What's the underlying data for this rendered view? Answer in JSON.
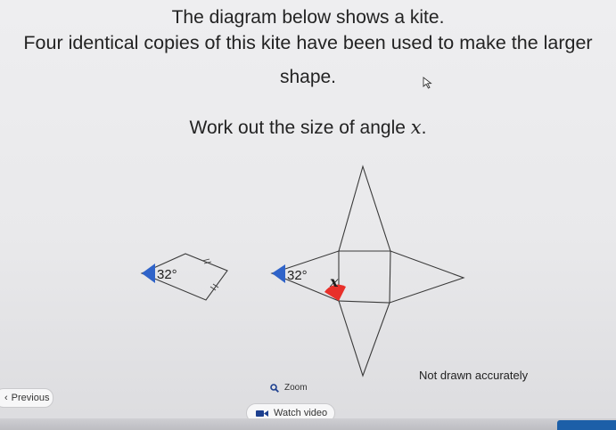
{
  "question": {
    "line1": "The diagram below shows a kite.",
    "line2": "Four identical copies of this kite have been used to make the larger",
    "line3": "shape.",
    "line4_prefix": "Work out the size of angle ",
    "line4_var": "x",
    "line4_suffix": "."
  },
  "diagram": {
    "kite_angle_label": "32°",
    "shape_angle_label": "32°",
    "unknown_label": "x",
    "marker_color": "#2f63c9",
    "highlight_color": "#e8302a",
    "note": "Not drawn accurately"
  },
  "controls": {
    "zoom_label": "Zoom",
    "zoom_icon": "search-icon",
    "previous_label": "Previous",
    "previous_icon": "chevron-left-icon",
    "watch_video_label": "Watch video",
    "watch_video_icon": "video-camera-icon"
  }
}
